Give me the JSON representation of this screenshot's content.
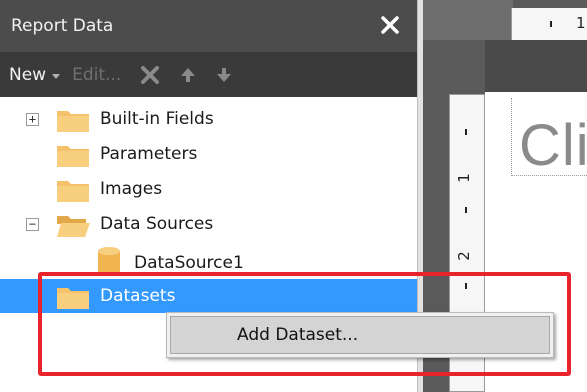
{
  "pane": {
    "title": "Report Data",
    "close_icon": "close-icon"
  },
  "toolbar": {
    "new_label": "New",
    "edit_label": "Edit...",
    "icons": [
      "delete-icon",
      "move-up-icon",
      "move-down-icon"
    ]
  },
  "tree": {
    "items": [
      {
        "label": "Built-in Fields",
        "expander": "+",
        "icon": "folder-icon"
      },
      {
        "label": "Parameters",
        "icon": "folder-icon"
      },
      {
        "label": "Images",
        "icon": "folder-icon"
      },
      {
        "label": "Data Sources",
        "expander": "−",
        "icon": "open-folder-icon"
      },
      {
        "label": "DataSource1",
        "icon": "datasource-icon"
      },
      {
        "label": "Datasets",
        "icon": "folder-icon",
        "selected": true
      }
    ]
  },
  "context_menu": {
    "items": [
      {
        "label": "Add Dataset..."
      }
    ]
  },
  "designer": {
    "ruler_top_mark": "1",
    "ruler_left_marks": [
      "1",
      "2"
    ],
    "report_title_partial": "Cli"
  },
  "colors": {
    "selection": "#3399ff",
    "highlight": "#e8232b",
    "pane_header": "#4c4c4c",
    "folder": "#f5c26b"
  }
}
